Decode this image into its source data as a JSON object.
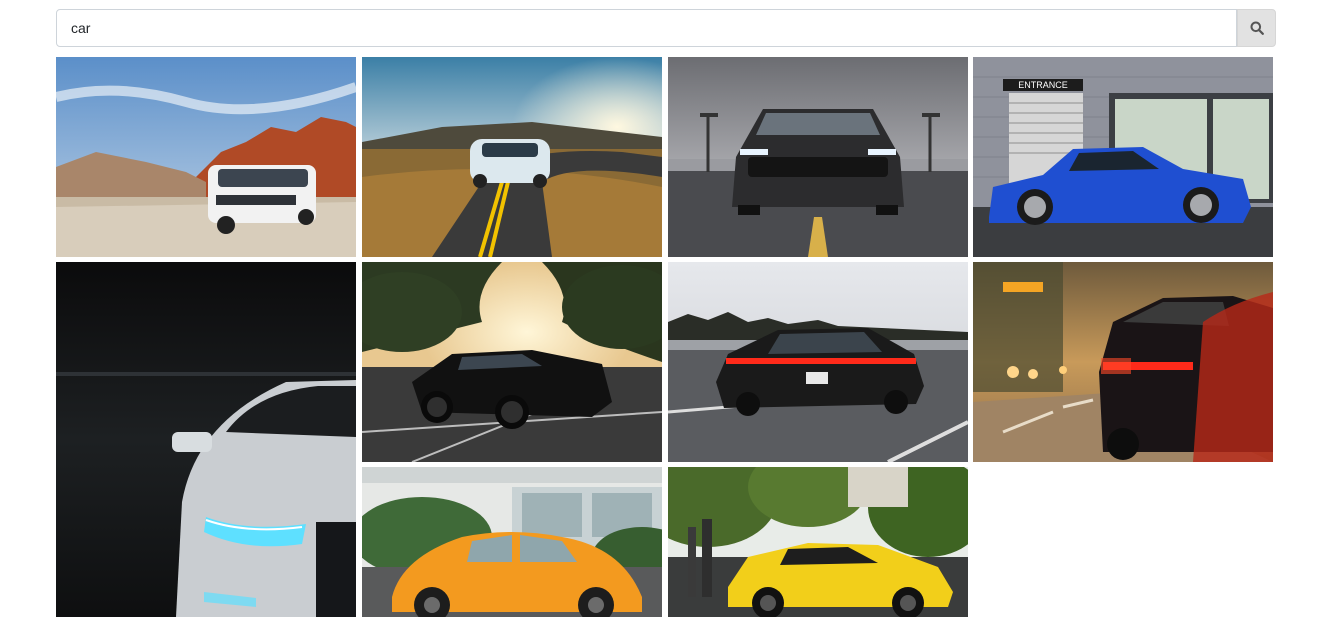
{
  "search": {
    "value": "car",
    "button_icon": "search-icon"
  },
  "gallery": {
    "items": [
      {
        "subject": "white-suv-desert-road",
        "accent": "#f2f2f2"
      },
      {
        "subject": "white-sports-car-winding-road-sunset",
        "accent": "#dce8ee"
      },
      {
        "subject": "black-mustang-parking-lot",
        "accent": "#2c2c2e"
      },
      {
        "subject": "blue-coupe-entrance-building",
        "accent": "#1f4fd1"
      },
      {
        "subject": "white-audi-headlight-dark-garage",
        "accent": "#5ee0ff"
      },
      {
        "subject": "black-mustang-sunset-trees",
        "accent": "#111111"
      },
      {
        "subject": "black-porsche-highway",
        "accent": "#1a1a1a"
      },
      {
        "subject": "red-audi-city-street-night",
        "accent": "#ff2a1a"
      },
      {
        "subject": "orange-beetle-street",
        "accent": "#f39a1f"
      },
      {
        "subject": "yellow-lamborghini-park",
        "accent": "#f2cf1a"
      }
    ]
  },
  "tile_text": {
    "entrance_sign": "ENTRANCE"
  }
}
